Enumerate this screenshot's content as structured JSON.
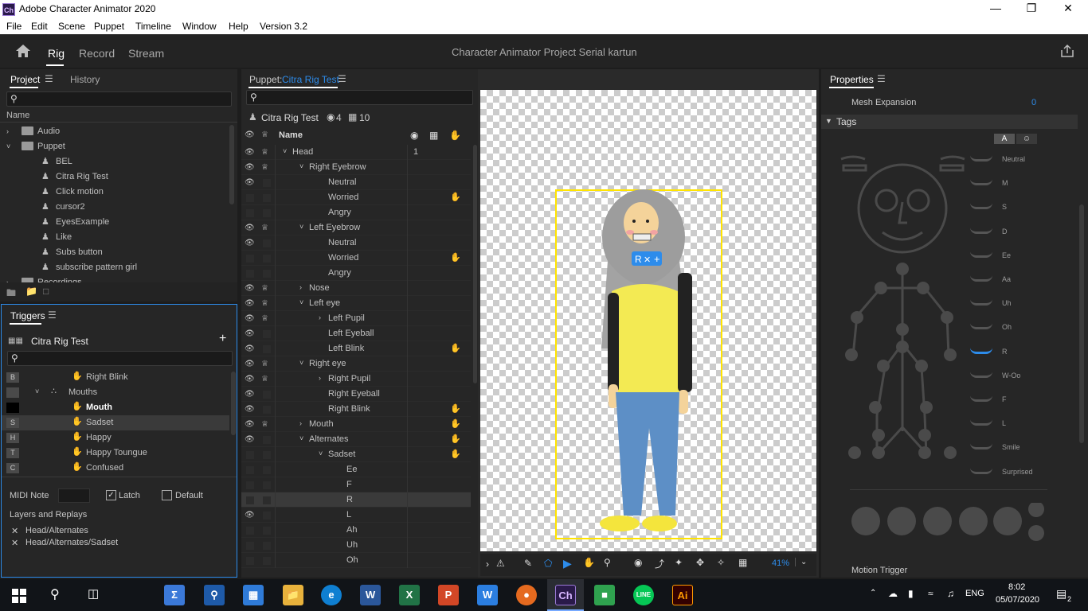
{
  "window": {
    "title": "Adobe Character Animator 2020",
    "app_icon": "Ch"
  },
  "menu": [
    "File",
    "Edit",
    "Scene",
    "Puppet",
    "Timeline",
    "Window",
    "Help",
    "Version 3.2"
  ],
  "modes": {
    "rig": "Rig",
    "record": "Record",
    "stream": "Stream"
  },
  "project_title": "Character Animator Project Serial kartun",
  "project_panel": {
    "tab_project": "Project",
    "tab_history": "History",
    "col_name": "Name",
    "items": [
      {
        "label": "Audio",
        "type": "folder",
        "expanded": false
      },
      {
        "label": "Puppet",
        "type": "folder",
        "expanded": true
      },
      {
        "label": "BEL",
        "type": "puppet"
      },
      {
        "label": "Citra Rig Test",
        "type": "puppet"
      },
      {
        "label": "Click motion",
        "type": "puppet"
      },
      {
        "label": "cursor2",
        "type": "puppet"
      },
      {
        "label": "EyesExample",
        "type": "puppet"
      },
      {
        "label": "Like",
        "type": "puppet"
      },
      {
        "label": "Subs button",
        "type": "puppet"
      },
      {
        "label": "subscribe pattern girl",
        "type": "puppet"
      },
      {
        "label": "Recordings",
        "type": "folder",
        "expanded": false
      }
    ]
  },
  "triggers_panel": {
    "title": "Triggers",
    "puppet": "Citra Rig Test",
    "items": [
      {
        "key": "B",
        "label": "Right Blink",
        "indent": 2
      },
      {
        "key": "",
        "label": "Mouths",
        "indent": 1
      },
      {
        "key": "",
        "label": "Mouth",
        "indent": 2,
        "bold": true
      },
      {
        "key": "S",
        "label": "Sadset",
        "indent": 2,
        "selected": true
      },
      {
        "key": "H",
        "label": "Happy",
        "indent": 2
      },
      {
        "key": "T",
        "label": "Happy Toungue",
        "indent": 2
      },
      {
        "key": "C",
        "label": "Confused",
        "indent": 2
      }
    ],
    "midi_label": "MIDI Note",
    "latch_label": "Latch",
    "default_label": "Default",
    "layers_title": "Layers and Replays",
    "layers": [
      "Head/Alternates",
      "Head/Alternates/Sadset"
    ]
  },
  "puppet_panel": {
    "label": "Puppet:",
    "puppet_name": "Citra Rig Test",
    "summary_name": "Citra Rig Test",
    "count_handles": "4",
    "count_groups": "10",
    "col_name": "Name",
    "rows": [
      {
        "label": "Head",
        "indent": 0,
        "eye": true,
        "crown": true,
        "chev": "v",
        "num": "1"
      },
      {
        "label": "Right Eyebrow",
        "indent": 1,
        "eye": true,
        "crown": true,
        "chev": "v"
      },
      {
        "label": "Neutral",
        "indent": 2,
        "eye": true
      },
      {
        "label": "Worried",
        "indent": 2,
        "eye": false,
        "trig": true
      },
      {
        "label": "Angry",
        "indent": 2,
        "eye": false
      },
      {
        "label": "Left Eyebrow",
        "indent": 1,
        "eye": true,
        "crown": true,
        "chev": "v"
      },
      {
        "label": "Neutral",
        "indent": 2,
        "eye": true
      },
      {
        "label": "Worried",
        "indent": 2,
        "eye": false,
        "trig": true
      },
      {
        "label": "Angry",
        "indent": 2,
        "eye": false
      },
      {
        "label": "Nose",
        "indent": 1,
        "eye": true,
        "crown": true,
        "chev": ">"
      },
      {
        "label": "Left eye",
        "indent": 1,
        "eye": true,
        "crown": true,
        "chev": "v"
      },
      {
        "label": "Left Pupil",
        "indent": 2,
        "eye": true,
        "crown": true,
        "chev": ">"
      },
      {
        "label": "Left Eyeball",
        "indent": 2,
        "eye": true
      },
      {
        "label": "Left Blink",
        "indent": 2,
        "eye": true,
        "trig": true
      },
      {
        "label": "Right eye",
        "indent": 1,
        "eye": true,
        "crown": true,
        "chev": "v"
      },
      {
        "label": "Right Pupil",
        "indent": 2,
        "eye": true,
        "crown": true,
        "chev": ">"
      },
      {
        "label": "Right Eyeball",
        "indent": 2,
        "eye": true
      },
      {
        "label": "Right Blink",
        "indent": 2,
        "eye": true,
        "trig": true
      },
      {
        "label": "Mouth",
        "indent": 1,
        "eye": true,
        "crown": true,
        "chev": ">",
        "trig": true
      },
      {
        "label": "Alternates",
        "indent": 1,
        "eye": true,
        "chev": "v",
        "trig": true
      },
      {
        "label": "Sadset",
        "indent": 2,
        "eye": false,
        "chev": "v",
        "trig": true
      },
      {
        "label": "Ee",
        "indent": 3,
        "eye": false
      },
      {
        "label": "F",
        "indent": 3,
        "eye": false
      },
      {
        "label": "R",
        "indent": 3,
        "eye": false,
        "selected": true
      },
      {
        "label": "L",
        "indent": 3,
        "eye": true
      },
      {
        "label": "Ah",
        "indent": 3,
        "eye": false
      },
      {
        "label": "Uh",
        "indent": 3,
        "eye": false
      },
      {
        "label": "Oh",
        "indent": 3,
        "eye": false
      }
    ]
  },
  "scene": {
    "zoom": "41%",
    "handle_label": "R"
  },
  "properties_panel": {
    "title": "Properties",
    "mesh_label": "Mesh Expansion",
    "mesh_value": "0",
    "tags_title": "Tags",
    "tag_tab_a": "A",
    "visemes": [
      "Neutral",
      "M",
      "S",
      "D",
      "Ee",
      "Aa",
      "Uh",
      "Oh",
      "R",
      "W-Oo",
      "F",
      "L",
      "Smile",
      "Surprised"
    ],
    "motion_trigger": "Motion Trigger"
  },
  "taskbar": {
    "lang": "ENG",
    "time": "8:02",
    "date": "05/07/2020",
    "notif": "2"
  },
  "colors": {
    "accent": "#2d8ceb",
    "selection_yellow": "#ffe400",
    "panel": "#262626"
  }
}
